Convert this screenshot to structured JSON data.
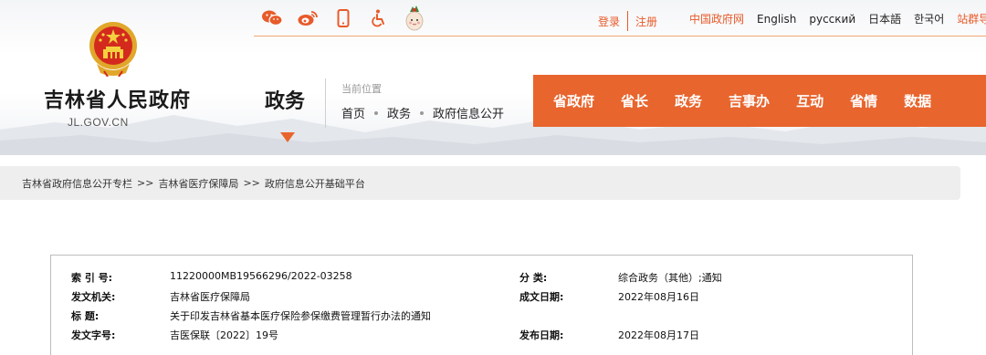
{
  "header": {
    "site_name": "吉林省人民政府",
    "site_domain": "JL.GOV.CN",
    "section_title": "政务",
    "login": "登录",
    "register": "注册",
    "lang_links": [
      "中国政府网",
      "English",
      "русский",
      "日本語",
      "한국어",
      "站群导航"
    ],
    "icons": [
      "wechat-icon",
      "weibo-icon",
      "mobile-icon",
      "accessibility-icon",
      "mascot-icon"
    ],
    "colors": {
      "accent": "#e8652e",
      "link_accent": "#e85a2a"
    }
  },
  "location": {
    "caption": "当前位置",
    "path": [
      "首页",
      "政务",
      "政府信息公开"
    ]
  },
  "main_nav": [
    "省政府",
    "省长",
    "政务",
    "吉事办",
    "互动",
    "省情",
    "数据"
  ],
  "breadcrumb": [
    "吉林省政府信息公开专栏",
    "吉林省医疗保障局",
    "政府信息公开基础平台"
  ],
  "breadcrumb_sep": ">>",
  "info": {
    "index_no_label": "索  引  号:",
    "index_no": "11220000MB19566296/2022-03258",
    "category_label": "分    类:",
    "category": "综合政务（其他）;通知",
    "issuer_label": "发文机关:",
    "issuer": "吉林省医疗保障局",
    "created_label": "成文日期:",
    "created": "2022年08月16日",
    "title_label": "标      题:",
    "title": "关于印发吉林省基本医疗保险参保缴费管理暂行办法的通知",
    "doc_no_label": "发文字号:",
    "doc_no": "吉医保联〔2022〕19号",
    "published_label": "发布日期:",
    "published": "2022年08月17日"
  }
}
